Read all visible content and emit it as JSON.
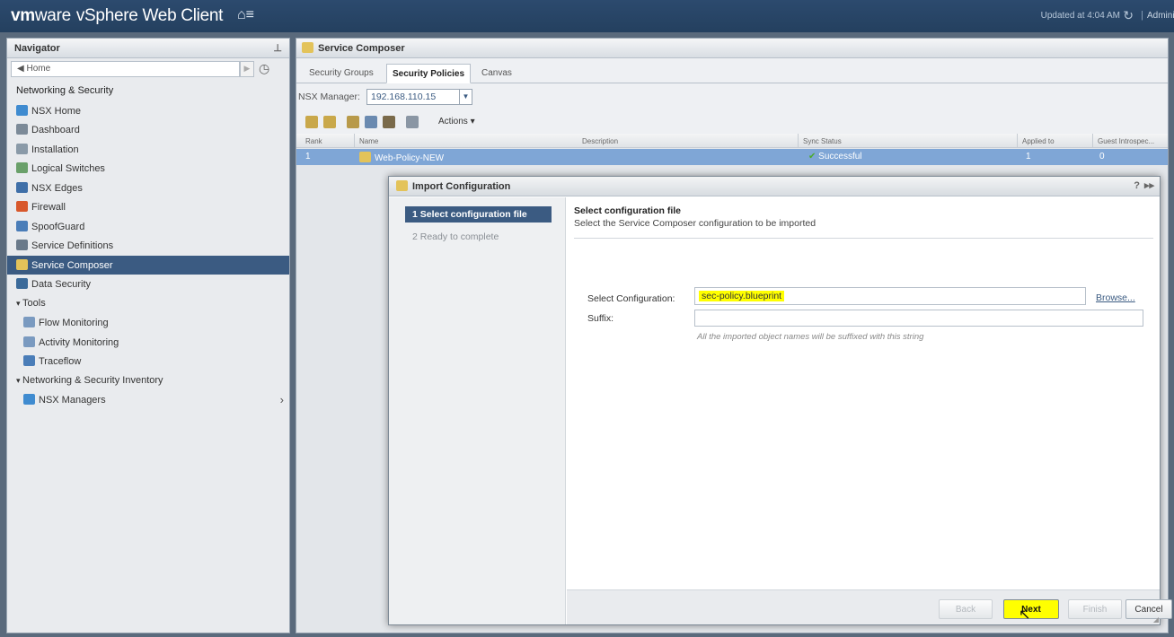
{
  "topbar": {
    "brand_vm": "vm",
    "brand_ware": "ware",
    "product": "vSphere Web Client",
    "home_icon": "home-menu-icon",
    "updated": "Updated at 4:04 AM",
    "separator": "|",
    "user": "Adminis"
  },
  "navigator": {
    "title": "Navigator",
    "home": "Home",
    "back_arrow": "◀",
    "forward_arrow": "▶",
    "items": [
      {
        "label": "Networking & Security",
        "kind": "section"
      },
      {
        "label": "NSX Home",
        "icon": "nsx-home-icon",
        "color": "#3f8bd0"
      },
      {
        "label": "Dashboard",
        "icon": "dashboard-icon",
        "color": "#7c8a98"
      },
      {
        "label": "Installation",
        "icon": "installation-icon",
        "color": "#8a9aa8"
      },
      {
        "label": "Logical Switches",
        "icon": "logical-switches-icon",
        "color": "#6aa06a"
      },
      {
        "label": "NSX Edges",
        "icon": "nsx-edges-icon",
        "color": "#3f6fa8"
      },
      {
        "label": "Firewall",
        "icon": "firewall-icon",
        "color": "#d8582c"
      },
      {
        "label": "SpoofGuard",
        "icon": "spoofguard-icon",
        "color": "#4a7db8"
      },
      {
        "label": "Service Definitions",
        "icon": "service-definitions-icon",
        "color": "#6a7a8a"
      },
      {
        "label": "Service Composer",
        "icon": "service-composer-icon",
        "color": "#e3c35a",
        "selected": true
      },
      {
        "label": "Data Security",
        "icon": "data-security-icon",
        "color": "#3b6a9a"
      },
      {
        "label": "Tools",
        "kind": "section-collapsible"
      },
      {
        "label": "Flow Monitoring",
        "icon": "flow-monitoring-icon",
        "color": "#7a9ac0",
        "sub": true
      },
      {
        "label": "Activity Monitoring",
        "icon": "activity-monitoring-icon",
        "color": "#7a9ac0",
        "sub": true
      },
      {
        "label": "Traceflow",
        "icon": "traceflow-icon",
        "color": "#4a7db8",
        "sub": true
      },
      {
        "label": "Networking & Security Inventory",
        "kind": "section-collapsible"
      },
      {
        "label": "NSX Managers",
        "icon": "nsx-managers-icon",
        "color": "#3f8bd0",
        "sub": true,
        "has_arrow": true
      }
    ]
  },
  "main": {
    "title": "Service Composer",
    "tabs": [
      "Security Groups",
      "Security Policies",
      "Canvas"
    ],
    "active_tab": "Security Policies",
    "nsx_manager_label": "NSX Manager:",
    "nsx_manager_value": "192.168.110.15",
    "actions_label": "Actions",
    "grid": {
      "columns": [
        "Rank",
        "Name",
        "Description",
        "Sync Status",
        "Applied to",
        "Guest Introspec..."
      ],
      "rows": [
        {
          "rank": "1",
          "name": "Web-Policy-NEW",
          "description": "",
          "sync_status": "Successful",
          "applied_to": "1",
          "guest": "0"
        }
      ]
    }
  },
  "dialog": {
    "title": "Import Configuration",
    "steps": [
      "1  Select configuration file",
      "2  Ready to complete"
    ],
    "content_title": "Select configuration file",
    "content_subtitle": "Select the Service Composer configuration to be imported",
    "select_config_label": "Select Configuration:",
    "select_config_value": "sec-policy.blueprint",
    "browse_label": "Browse...",
    "suffix_label": "Suffix:",
    "suffix_value": "",
    "suffix_hint": "All the imported object names will be suffixed with this string",
    "buttons": {
      "back": "Back",
      "next": "Next",
      "finish": "Finish",
      "cancel": "Cancel"
    }
  },
  "colors": {
    "topbar": "#2c4a6e",
    "selected": "#3b5b82",
    "row_highlight": "#7fa6d6",
    "highlight": "#ffff00"
  }
}
